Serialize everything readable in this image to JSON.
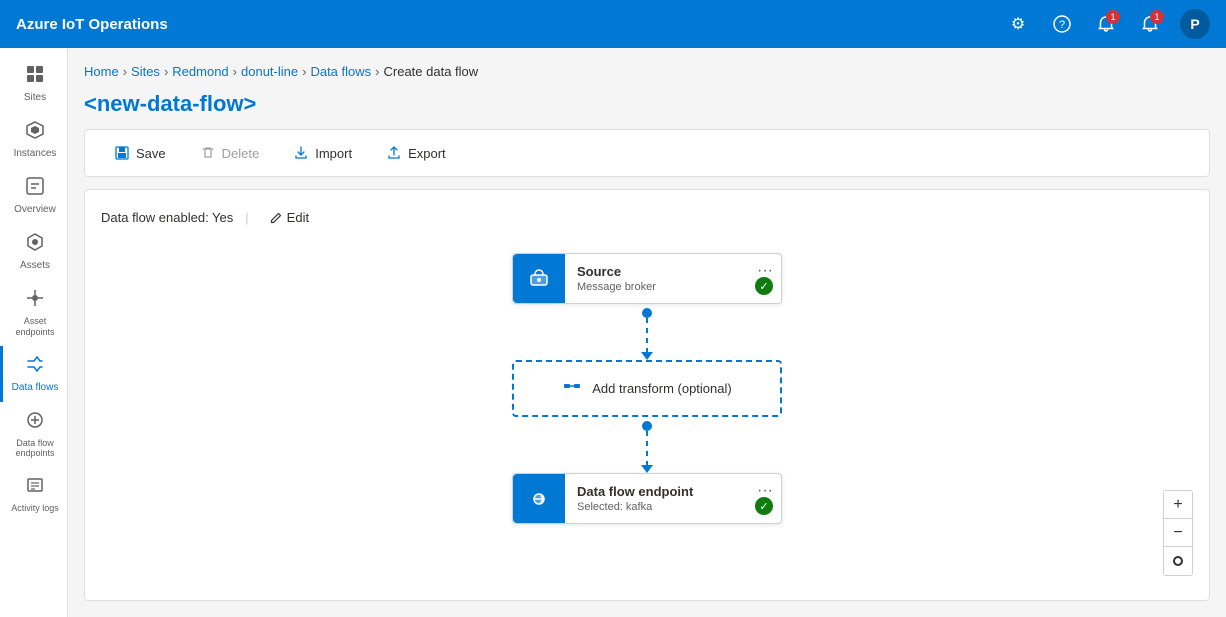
{
  "app": {
    "title": "Azure IoT Operations"
  },
  "topbar": {
    "icons": {
      "settings": "⚙",
      "help": "?",
      "notifications1": "🔔",
      "notifications2": "🔔",
      "notifications1_badge": "1",
      "notifications2_badge": "1",
      "avatar_label": "P"
    }
  },
  "sidebar": {
    "items": [
      {
        "id": "sites",
        "label": "Sites",
        "icon": "⊞",
        "active": false
      },
      {
        "id": "instances",
        "label": "Instances",
        "icon": "⬡",
        "active": false
      },
      {
        "id": "overview",
        "label": "Overview",
        "icon": "⊡",
        "active": false
      },
      {
        "id": "assets",
        "label": "Assets",
        "icon": "◈",
        "active": false
      },
      {
        "id": "asset-endpoints",
        "label": "Asset endpoints",
        "icon": "✦",
        "active": false
      },
      {
        "id": "data-flows",
        "label": "Data flows",
        "icon": "⇌",
        "active": true
      },
      {
        "id": "data-flow-endpoints",
        "label": "Data flow endpoints",
        "icon": "⊕",
        "active": false
      },
      {
        "id": "activity-logs",
        "label": "Activity logs",
        "icon": "≡",
        "active": false
      }
    ]
  },
  "breadcrumb": {
    "items": [
      "Home",
      "Sites",
      "Redmond",
      "donut-line",
      "Data flows"
    ],
    "current": "Create data flow",
    "separator": ">"
  },
  "page": {
    "title": "<new-data-flow>"
  },
  "toolbar": {
    "save": "Save",
    "delete": "Delete",
    "import": "Import",
    "export": "Export"
  },
  "flow": {
    "status_label": "Data flow enabled: Yes",
    "edit_label": "Edit",
    "source_node": {
      "title": "Source",
      "subtitle": "Message broker",
      "menu": "···",
      "has_check": true
    },
    "transform_node": {
      "label": "Add transform (optional)"
    },
    "destination_node": {
      "title": "Data flow endpoint",
      "subtitle": "Selected: kafka",
      "menu": "···",
      "has_check": true
    }
  },
  "zoom": {
    "plus": "+",
    "minus": "−"
  }
}
